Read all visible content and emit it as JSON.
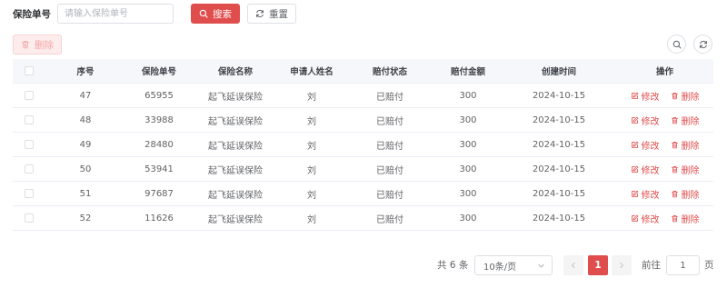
{
  "search": {
    "label": "保险单号",
    "placeholder": "请输入保险单号",
    "search_label": "搜索",
    "reset_label": "重置"
  },
  "toolbar": {
    "delete_label": "删除"
  },
  "table": {
    "headers": [
      "序号",
      "保险单号",
      "保险名称",
      "申请人姓名",
      "赔付状态",
      "赔付金额",
      "创建时间",
      "操作"
    ],
    "rows": [
      {
        "seq": "47",
        "no": "65955",
        "name": "起飞延误保险",
        "applicant": "刘",
        "status": "已赔付",
        "amount": "300",
        "created": "2024-10-15"
      },
      {
        "seq": "48",
        "no": "33988",
        "name": "起飞延误保险",
        "applicant": "刘",
        "status": "已赔付",
        "amount": "300",
        "created": "2024-10-15"
      },
      {
        "seq": "49",
        "no": "28480",
        "name": "起飞延误保险",
        "applicant": "刘",
        "status": "已赔付",
        "amount": "300",
        "created": "2024-10-15"
      },
      {
        "seq": "50",
        "no": "53941",
        "name": "起飞延误保险",
        "applicant": "刘",
        "status": "已赔付",
        "amount": "300",
        "created": "2024-10-15"
      },
      {
        "seq": "51",
        "no": "97687",
        "name": "起飞延误保险",
        "applicant": "刘",
        "status": "已赔付",
        "amount": "300",
        "created": "2024-10-15"
      },
      {
        "seq": "52",
        "no": "11626",
        "name": "起飞延误保险",
        "applicant": "刘",
        "status": "已赔付",
        "amount": "300",
        "created": "2024-10-15"
      }
    ],
    "edit_label": "修改",
    "delete_label": "删除"
  },
  "pagination": {
    "total_text": "共 6 条",
    "page_size": "10条/页",
    "current_page": "1",
    "goto_label": "前往",
    "goto_value": "1",
    "goto_unit": "页"
  },
  "colors": {
    "accent": "#e04d4d",
    "border": "#dcdfe6",
    "header_bg": "#f5f7fa"
  },
  "icons": {
    "search_button": "search-icon",
    "reset_button": "refresh-icon",
    "delete_button": "trash-icon",
    "edit_link": "edit-icon",
    "page_size_dropdown": "chevron-down-icon",
    "prev": "chevron-left-icon",
    "next": "chevron-right-icon"
  }
}
